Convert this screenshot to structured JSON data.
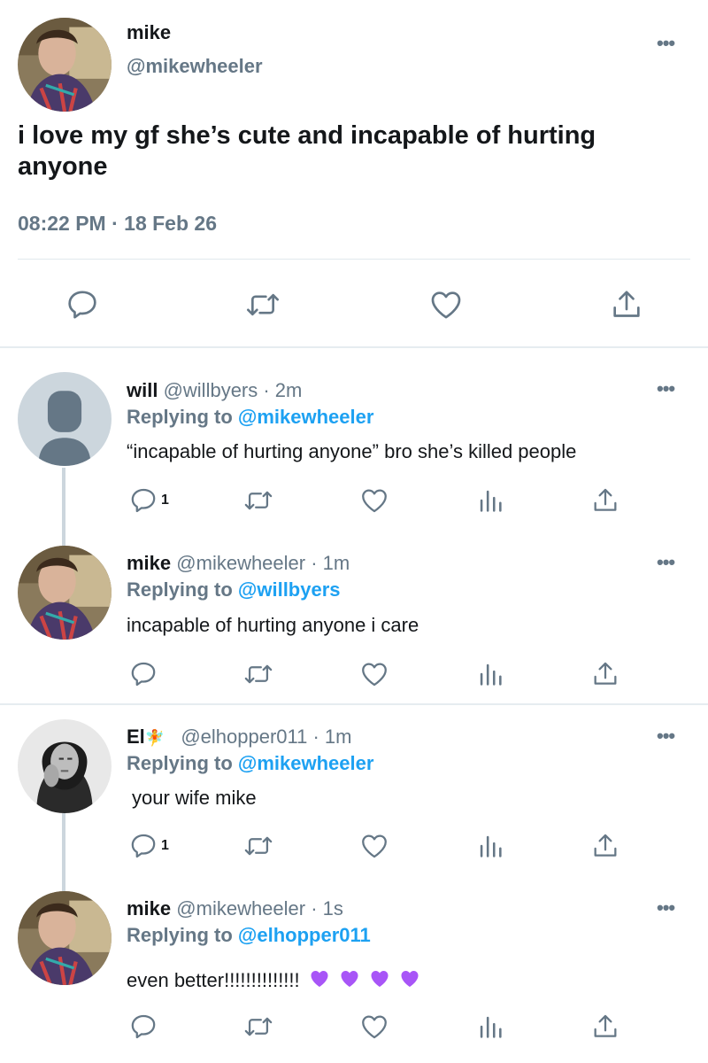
{
  "main_tweet": {
    "name": "mike",
    "handle": "@mikewheeler",
    "text": "i love my gf she’s cute and incapable of hurting anyone",
    "timestamp": "08:22 PM · 18 Feb 26",
    "more": "•••"
  },
  "replies": [
    {
      "name": "will",
      "meta": "@willbyers · 2m",
      "replying_prefix": "Replying to",
      "replying_to": "@mikewheeler",
      "text": "“incapable of hurting anyone” bro she’s killed people",
      "reply_count": "1",
      "more": "•••"
    },
    {
      "name": "mike",
      "meta": "@mikewheeler · 1m",
      "replying_prefix": "Replying to",
      "replying_to": "@willbyers",
      "text": "incapable of hurting anyone i care",
      "reply_count": "",
      "more": "•••"
    },
    {
      "name": "El",
      "name_emoji": "🧚",
      "meta": "@elhopper011 · 1m",
      "replying_prefix": "Replying to",
      "replying_to": "@mikewheeler",
      "text": "your wife mike",
      "reply_count": "1",
      "more": "•••"
    },
    {
      "name": "mike",
      "meta": "@mikewheeler · 1s",
      "replying_prefix": "Replying to",
      "replying_to": "@elhopper011",
      "text": "even better!!!!!!!!!!!!!!",
      "reply_count": "",
      "more": "•••"
    }
  ],
  "colors": {
    "accent": "#1da1f2",
    "secondary_text": "#657786",
    "icon_gray": "#657786",
    "purple_heart": "#a855f7"
  },
  "icons": [
    "reply-icon",
    "retweet-icon",
    "like-icon",
    "analytics-icon",
    "share-icon",
    "more-icon"
  ]
}
